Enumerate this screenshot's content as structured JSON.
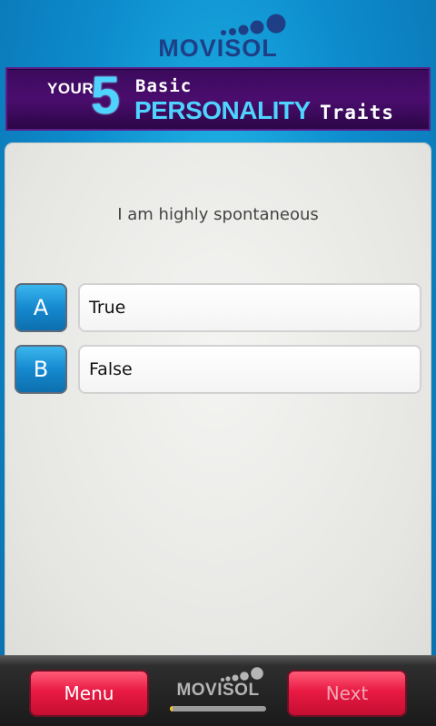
{
  "brand": {
    "name": "MOVISOL"
  },
  "banner": {
    "your": "YOUR",
    "number": "5",
    "basic": "Basic",
    "personality": "PERSONALITY",
    "traits": "Traits"
  },
  "question": {
    "text": "I am highly spontaneous",
    "options": [
      {
        "letter": "A",
        "label": "True"
      },
      {
        "letter": "B",
        "label": "False"
      }
    ]
  },
  "footer": {
    "menu_label": "Menu",
    "next_label": "Next",
    "next_enabled": false,
    "progress": 0.03
  },
  "colors": {
    "accent": "#4fd3ff",
    "button": "#e91a44",
    "option_button": "#1589cf",
    "banner": "#4a0d6e",
    "progress": "#f3c51d"
  }
}
